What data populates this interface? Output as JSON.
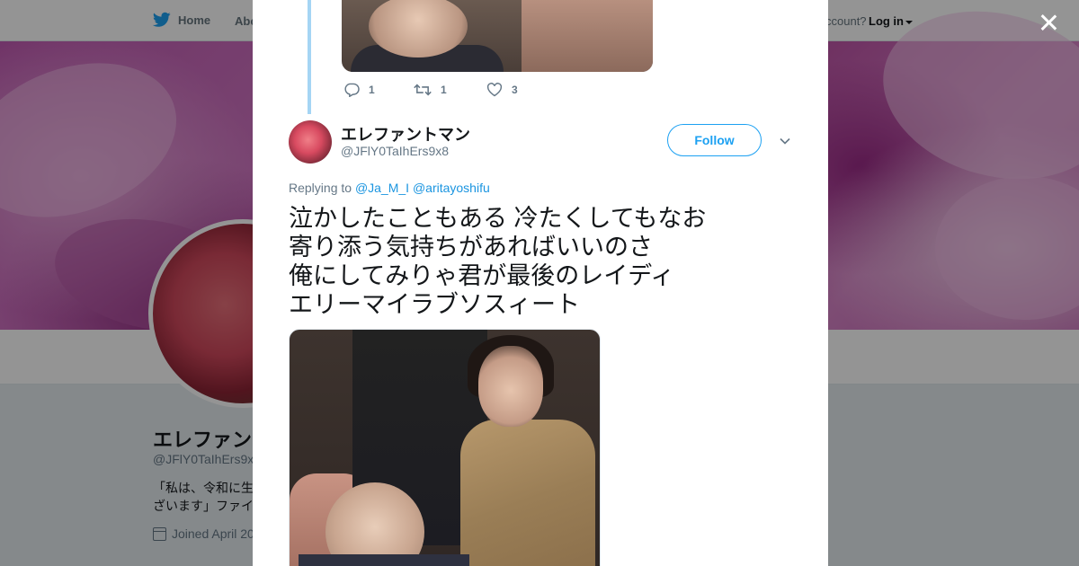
{
  "topbar": {
    "home_label": "Home",
    "about_label": "Abo",
    "account_prompt": "ccount?",
    "login_label": "Log in"
  },
  "profile": {
    "name": "エレファン",
    "handle": "@JFlY0TaIhErs9x",
    "bio": "「私は、令和に生\nざいます」ファイ",
    "joined": "Joined April 20"
  },
  "thread_prev": {
    "replies": "1",
    "retweets": "1",
    "likes": "3"
  },
  "tweet": {
    "display_name": "エレファントマン",
    "handle": "@JFlY0TaIhErs9x8",
    "follow_label": "Follow",
    "replying_prefix": "Replying to",
    "reply_mentions": [
      "@Ja_M_I",
      "@aritayoshifu"
    ],
    "text": "泣かしたこともある  冷たくしてもなお\n寄り添う気持ちがあればいいのさ\n俺にしてみりゃ君が最後のレイディ\nエリーマイラブソスィート"
  },
  "colors": {
    "twitter_blue": "#1da1f2",
    "mention_blue": "#1b95e0",
    "thread_line": "#a5d5f4",
    "text_primary": "#14171a",
    "text_secondary": "#657786"
  },
  "icons": {
    "logo": "twitter-bird-icon",
    "close": "close-icon",
    "reply": "reply-icon",
    "retweet": "retweet-icon",
    "like": "heart-icon",
    "more": "chevron-down-icon",
    "calendar": "calendar-icon"
  }
}
